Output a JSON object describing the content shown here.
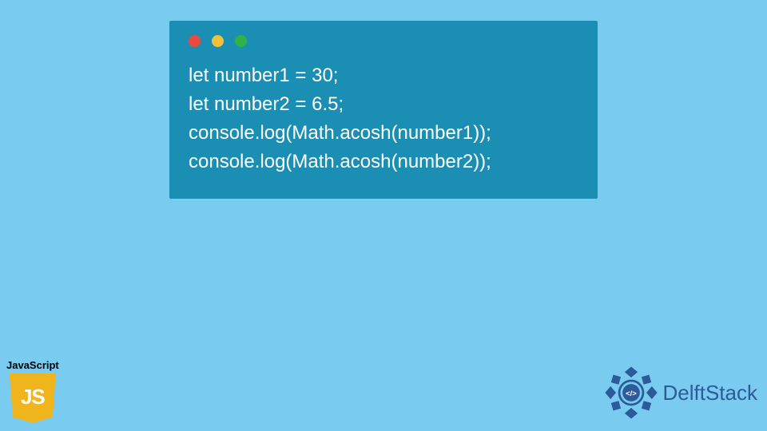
{
  "code": {
    "lines": [
      "let number1 = 30;",
      "let number2 = 6.5;",
      "console.log(Math.acosh(number1));",
      "console.log(Math.acosh(number2));"
    ]
  },
  "js_badge": {
    "label": "JavaScript",
    "logo_text": "JS"
  },
  "brand": {
    "name": "DelftStack",
    "icon_symbol": "</>"
  },
  "colors": {
    "background": "#79ccef",
    "window": "#1b8eb3",
    "js_shield": "#f0b41d",
    "brand_text": "#2d5b99"
  }
}
